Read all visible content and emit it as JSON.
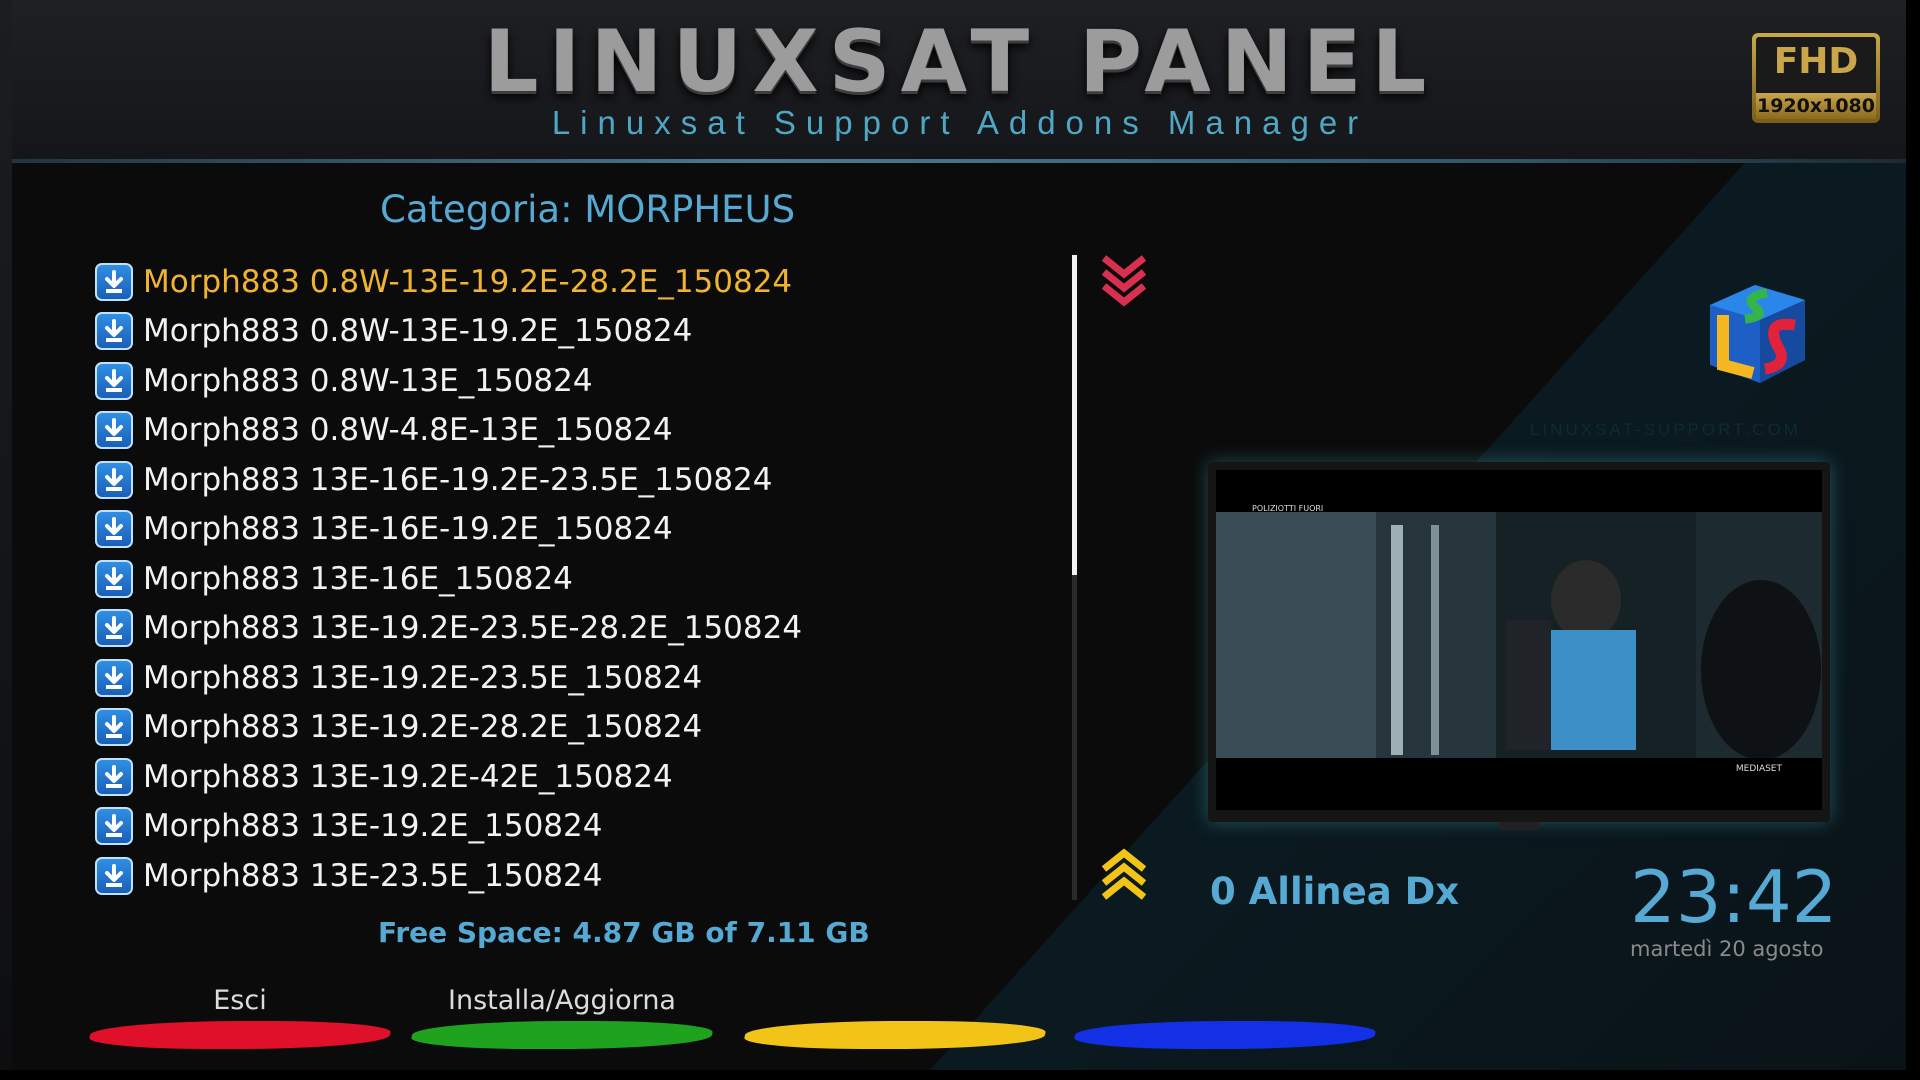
{
  "header": {
    "title": "LINUXSAT PANEL",
    "subtitle": "Linuxsat Support Addons Manager",
    "badge_top": "FHD",
    "badge_bottom": "1920x1080"
  },
  "category": "Categoria: MORPHEUS",
  "list": {
    "selected_index": 0,
    "items": [
      "Morph883 0.8W-13E-19.2E-28.2E_150824",
      "Morph883 0.8W-13E-19.2E_150824",
      "Morph883 0.8W-13E_150824",
      "Morph883 0.8W-4.8E-13E_150824",
      "Morph883 13E-16E-19.2E-23.5E_150824",
      "Morph883 13E-16E-19.2E_150824",
      "Morph883 13E-16E_150824",
      "Morph883 13E-19.2E-23.5E-28.2E_150824",
      "Morph883 13E-19.2E-23.5E_150824",
      "Morph883 13E-19.2E-28.2E_150824",
      "Morph883 13E-19.2E-42E_150824",
      "Morph883 13E-19.2E_150824",
      "Morph883 13E-23.5E_150824"
    ]
  },
  "free_space": "Free Space: 4.87 GB of 7.11 GB",
  "site": "LINUXSAT-SUPPORT.COM",
  "tv": {
    "caption": "POLIZIOTTI FUORI",
    "brand": "MEDIASET"
  },
  "align_label": "0 Allinea Dx",
  "clock": "23:42",
  "date": "martedì 20 agosto",
  "buttons": {
    "red": "Esci",
    "green": "Installa/Aggiorna",
    "yellow": "",
    "blue": ""
  },
  "colors": {
    "accent": "#56a9d2",
    "selected": "#f0b432",
    "red": "#e0102a",
    "green": "#1fa31f",
    "yellow": "#f2c417",
    "blue": "#1330e6"
  }
}
